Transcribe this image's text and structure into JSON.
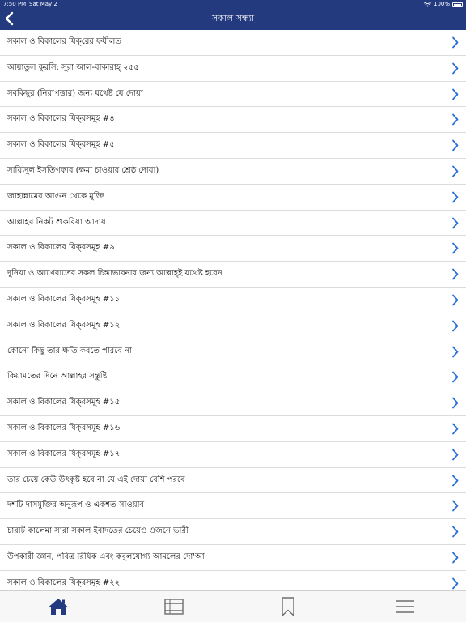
{
  "status_bar": {
    "time": "7:50 PM",
    "date": "Sat May 2",
    "battery": "100%",
    "icons": [
      "wifi-icon",
      "battery-icon"
    ]
  },
  "header": {
    "title": "সকাল সন্ধ্যা",
    "back_icon": "chevron-left-icon",
    "background": "#233a7f"
  },
  "list": {
    "chevron_color": "#2a6fd6",
    "items": [
      "সকাল ও বিকালের যিক্‌রের ফযীলত",
      "আয়াতুল কুরসি: সূরা আল-বাকারাহ্‌ ২৫৫",
      "সবকিছুর (নিরাপত্তার) জন্য যথেষ্ট যে দোয়া",
      "সকাল ও বিকালের যিক্‌রসমূহ #৪",
      "সকাল ও বিকালের যিক্‌রসমূহ #৫",
      "সায়্যিদুল ইসতিগফার (ক্ষমা চাওয়ার শ্রেষ্ঠ দোয়া)",
      "জাহান্নামের আগুন থেকে মুক্তি",
      "আল্লাহর নিকট শুকরিয়া আদায়",
      "সকাল ও বিকালের যিক্‌রসমূহ #৯",
      "দুনিয়া ও আখেরাতের সকল চিন্তাভাবনার জন্য আল্লাহ্‌ই যথেষ্ট হবেন",
      "সকাল ও বিকালের যিক্‌রসমূহ #১১",
      "সকাল ও বিকালের যিক্‌রসমূহ #১২",
      "কোনো কিছু তার ক্ষতি করতে পারবে না",
      "কিয়ামতের দিনে আল্লাহর সন্তুষ্টি",
      "সকাল ও বিকালের যিক্‌রসমূহ #১৫",
      "সকাল ও বিকালের যিক্‌রসমূহ #১৬",
      "সকাল ও বিকালের যিক্‌রসমূহ #১৭",
      "তার চেয়ে কেউ উৎকৃষ্ট হবে না যে এই দোয়া বেশি পরবে",
      "দশটি দাসমুক্তির অনুরূপ ও একশত সাওয়াব",
      "চারটি কালেমা সারা সকাল ইবাদতের চেয়েও ওজনে ভারী",
      "উপকারী জ্ঞান, পবিত্র রিযিক এবং কবুলযোগ্য আমলের দো'আ",
      "সকাল ও বিকালের যিক্‌রসমূহ #২২"
    ]
  },
  "tab_bar": {
    "tabs": [
      {
        "icon": "home-icon",
        "active": true
      },
      {
        "icon": "table-icon",
        "active": false
      },
      {
        "icon": "bookmark-icon",
        "active": false
      },
      {
        "icon": "menu-icon",
        "active": false
      }
    ],
    "active_color": "#233a7f",
    "inactive_color": "#6d6d6d"
  }
}
